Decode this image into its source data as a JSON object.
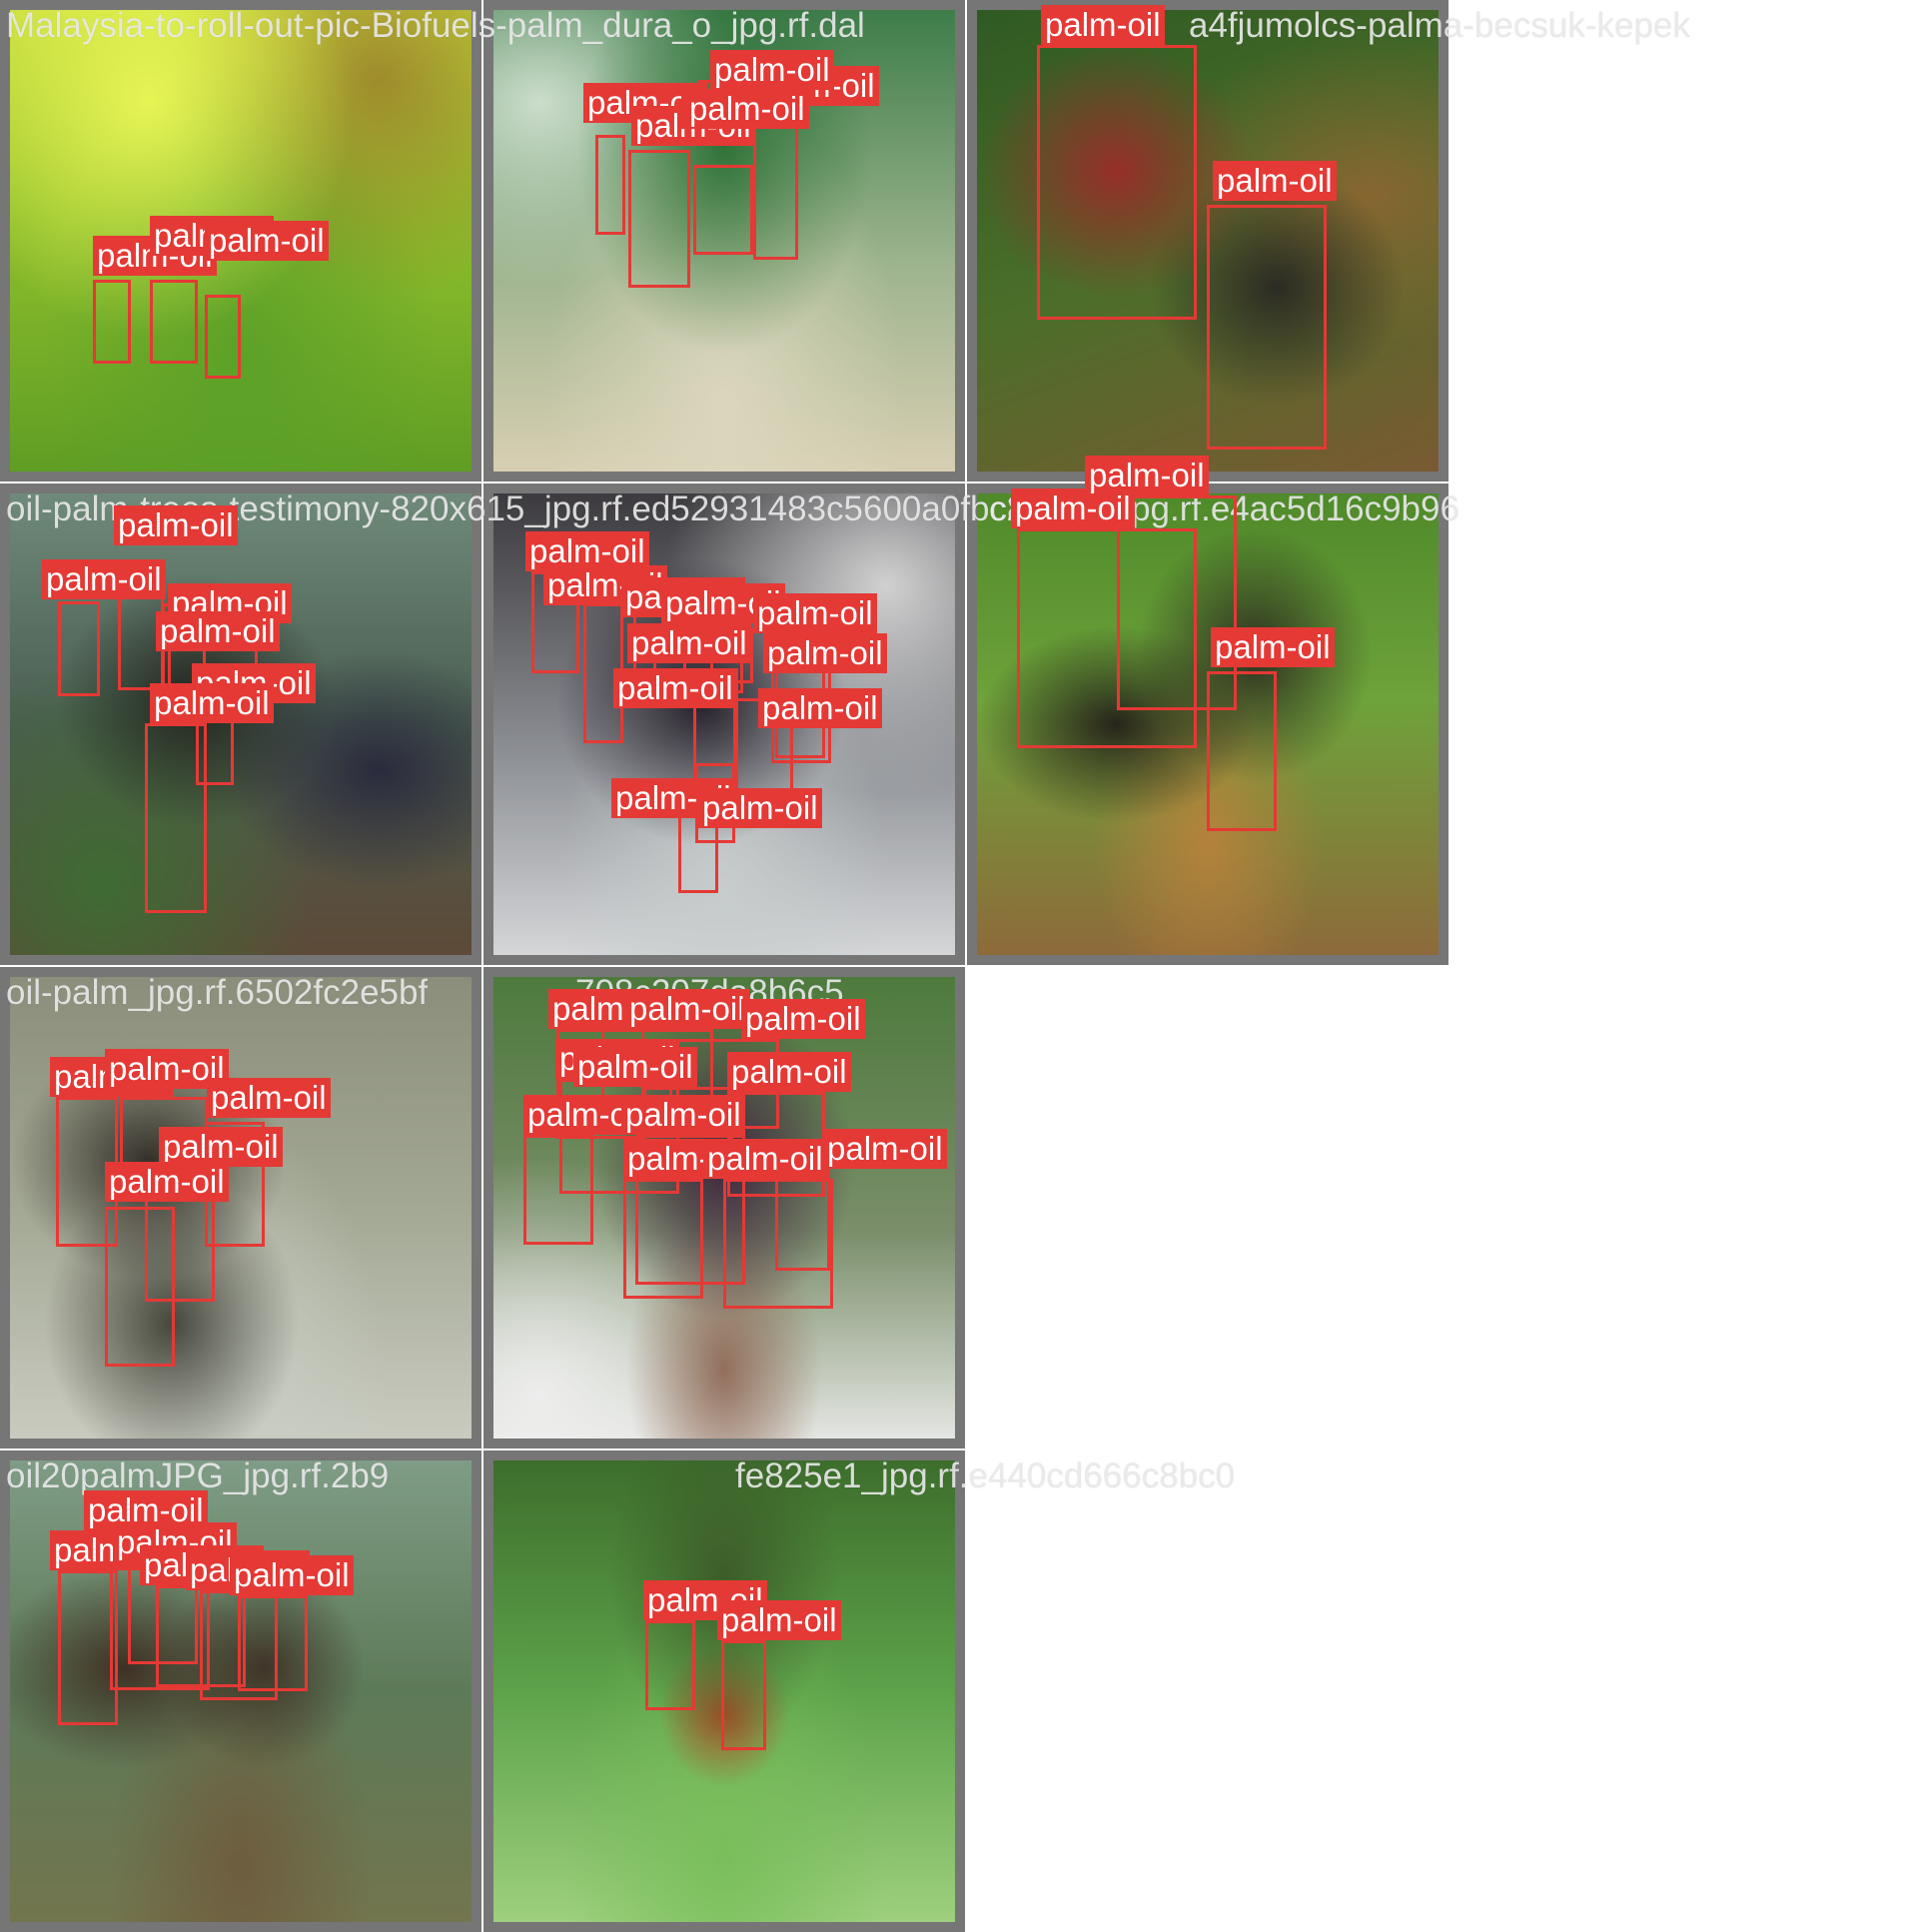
{
  "tiles": [
    {
      "filename": "Malaysia-to-roll-out-pic-Biofuels-palm_dura_o_jpg.rf.dal",
      "detections": [
        {
          "label": "palm-oil",
          "confidence": null
        },
        {
          "label": "palm-oil",
          "confidence": null
        },
        {
          "label": "palm-oil",
          "confidence": null
        }
      ]
    },
    {
      "filename": "",
      "detections": [
        {
          "label": "palm-oil"
        },
        {
          "label": "palm-oil"
        },
        {
          "label": "palm-oil"
        },
        {
          "label": "palm-oil"
        },
        {
          "label": "palm-oil"
        },
        {
          "label": "palm-oil"
        }
      ]
    },
    {
      "filename": "a4fjumolcs-palma-becsuk-kepek",
      "detections": [
        {
          "label": "palm-oil"
        },
        {
          "label": "palm-oil"
        }
      ]
    },
    {
      "filename": "oil-palm-trees-testimony-820x615_jpg.rf.ed52931483c5600a0fbc8a",
      "detections": [
        {
          "label": "palm-oil"
        },
        {
          "label": "palm-oil"
        },
        {
          "label": "palm-oil"
        },
        {
          "label": "palm-oil"
        },
        {
          "label": "palm-oil"
        },
        {
          "label": "palm-oil"
        }
      ]
    },
    {
      "filename": "",
      "detections": [
        {
          "label": "palm-oil"
        },
        {
          "label": "palm-oil"
        },
        {
          "label": "palm-oil"
        },
        {
          "label": "palm-oil"
        },
        {
          "label": "palm-oil"
        },
        {
          "label": "palm-oil"
        },
        {
          "label": "palm-oil"
        },
        {
          "label": "palm-oil"
        },
        {
          "label": "palm-oil"
        },
        {
          "label": "palm-oil"
        },
        {
          "label": "palm-oil"
        }
      ]
    },
    {
      "filename": "c208_7_jpg.rf.e4ac5d16c9b96",
      "detections": [
        {
          "label": "palm-oil"
        },
        {
          "label": "palm-oil"
        },
        {
          "label": "palm-oil"
        }
      ]
    },
    {
      "filename": "oil-palm_jpg.rf.6502fc2e5bf",
      "detections": [
        {
          "label": "palm-oil"
        },
        {
          "label": "palm-oil"
        },
        {
          "label": "palm-oil"
        },
        {
          "label": "palm-oil"
        },
        {
          "label": "palm-oil"
        }
      ]
    },
    {
      "filename": "708c207da8b6c5",
      "detections": [
        {
          "label": "palm-oil"
        },
        {
          "label": "palm-oil"
        },
        {
          "label": "palm-oil"
        },
        {
          "label": "palm-oil"
        },
        {
          "label": "palm-oil"
        },
        {
          "label": "palm-oil"
        },
        {
          "label": "palm-oil"
        },
        {
          "label": "palm-oil"
        },
        {
          "label": "palm-oil"
        },
        {
          "label": "palm-oil"
        },
        {
          "label": "palm-oil"
        }
      ]
    },
    {
      "filename": "oil20palmJPG_jpg.rf.2b9",
      "detections": [
        {
          "label": "palm-oil"
        },
        {
          "label": "palm-oil"
        },
        {
          "label": "palm-oil"
        },
        {
          "label": "palm-oil"
        },
        {
          "label": "palm-oil"
        },
        {
          "label": "palm-oil"
        }
      ]
    },
    {
      "filename": "fe825e1_jpg.rf.e440cd666c8bc0",
      "detections": [
        {
          "label": "palm-oil"
        },
        {
          "label": "palm-oil"
        }
      ]
    }
  ],
  "colors": {
    "box": "#e53935",
    "label_text": "#ffffff",
    "tile_border": "#767676",
    "filename_text": "#ebebeb"
  }
}
